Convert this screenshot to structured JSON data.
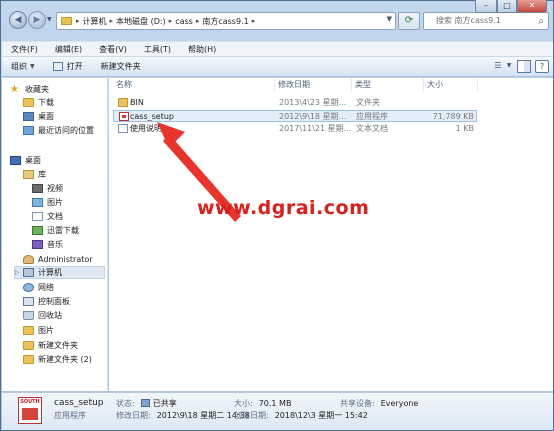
{
  "address": {
    "crumbs": [
      "计算机",
      "本地磁盘 (D:)",
      "cass",
      "南方cass9.1"
    ],
    "separator": "▸"
  },
  "search": {
    "placeholder": "搜索 南方cass9.1"
  },
  "menu": [
    "文件(F)",
    "编辑(E)",
    "查看(V)",
    "工具(T)",
    "帮助(H)"
  ],
  "toolbar": {
    "organize": "组织",
    "open": "打开",
    "new_folder": "新建文件夹"
  },
  "nav": {
    "favorites": "收藏夹",
    "downloads": "下载",
    "desktop_fav": "桌面",
    "recent": "最近访问的位置",
    "desktop": "桌面",
    "libraries": "库",
    "videos": "视频",
    "pictures": "图片",
    "documents": "文档",
    "thunder": "迅雷下载",
    "music": "音乐",
    "admin": "Administrator",
    "computer": "计算机",
    "network": "网络",
    "control_panel": "控制面板",
    "recycle": "回收站",
    "pictures2": "图片",
    "new_folder": "新建文件夹",
    "new_folder2": "新建文件夹 (2)"
  },
  "columns": {
    "name": "名称",
    "date": "修改日期",
    "type": "类型",
    "size": "大小"
  },
  "files": [
    {
      "name": "BIN",
      "date": "2013\\4\\23 星期...",
      "type": "文件夹",
      "size": ""
    },
    {
      "name": "cass_setup",
      "date": "2012\\9\\18 星期...",
      "type": "应用程序",
      "size": "71,789 KB"
    },
    {
      "name": "使用说明",
      "date": "2017\\11\\21 星期...",
      "type": "文本文档",
      "size": "1 KB"
    }
  ],
  "watermark": "www.dgrai.com",
  "details": {
    "icon_text": "SOUTH",
    "name": "cass_setup",
    "kind": "应用程序",
    "status_label": "状态:",
    "status_value": "已共享",
    "size_label": "大小:",
    "size_value": "70.1 MB",
    "share_label": "共享设备:",
    "share_value": "Everyone",
    "modified_label": "修改日期:",
    "modified_value": "2012\\9\\18 星期二 14:38",
    "created_label": "创建日期:",
    "created_value": "2018\\12\\3 星期一 15:42"
  },
  "colors": {
    "arrow": "#e8342b",
    "watermark": "#d9201c",
    "selection": "#e3eefb"
  }
}
